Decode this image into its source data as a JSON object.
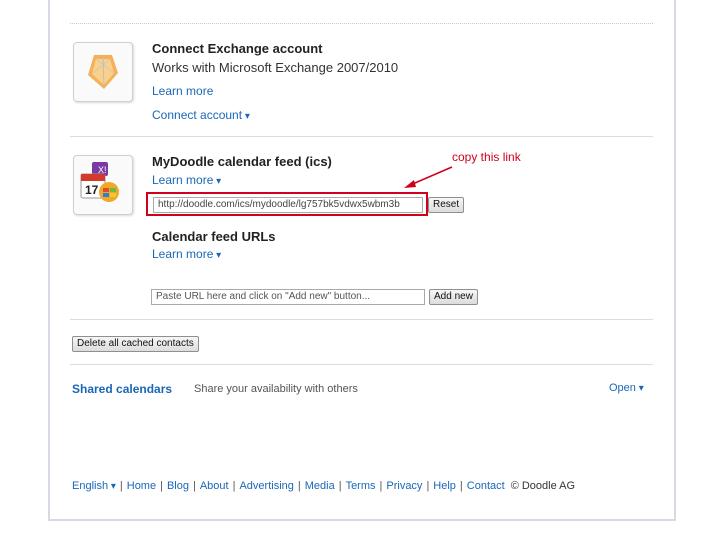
{
  "exchange": {
    "title": "Connect Exchange account",
    "subtitle": "Works with Microsoft Exchange 2007/2010",
    "learn_more": "Learn more",
    "connect": "Connect account"
  },
  "ics": {
    "title": "MyDoodle calendar feed (ics)",
    "learn_more": "Learn more",
    "feed_url": "http://doodle.com/ics/mydoodle/lg757bk5vdwx5wbm3b",
    "reset": "Reset",
    "annotation": "copy this link",
    "feeds_title": "Calendar feed URLs",
    "feeds_learn_more": "Learn more",
    "add_placeholder": "Paste URL here and click on \"Add new\" button...",
    "add_new": "Add new"
  },
  "delete_contacts": "Delete all cached contacts",
  "shared": {
    "title": "Shared calendars",
    "desc": "Share your availability with others",
    "open": "Open"
  },
  "footer": {
    "language": "English",
    "links": [
      "Home",
      "Blog",
      "About",
      "Advertising",
      "Media",
      "Terms",
      "Privacy",
      "Help",
      "Contact"
    ],
    "copyright": "© Doodle AG"
  },
  "colors": {
    "link": "#1a67b7",
    "annotation": "#d0021b"
  }
}
